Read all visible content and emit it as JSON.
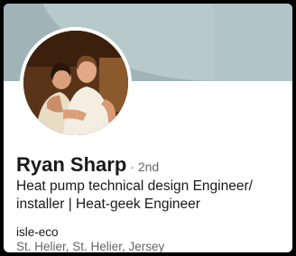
{
  "profile": {
    "name": "Ryan Sharp",
    "degree": "· 2nd",
    "headline": "Heat pump technical design Engineer/ installer | Heat-geek Engineer",
    "company": "isle-eco",
    "location": "St. Helier, St. Helier, Jersey"
  },
  "colors": {
    "banner": "#a0b4b7",
    "banner_light": "#b7c9cb",
    "text_primary": "#191919",
    "text_secondary": "#666666"
  }
}
